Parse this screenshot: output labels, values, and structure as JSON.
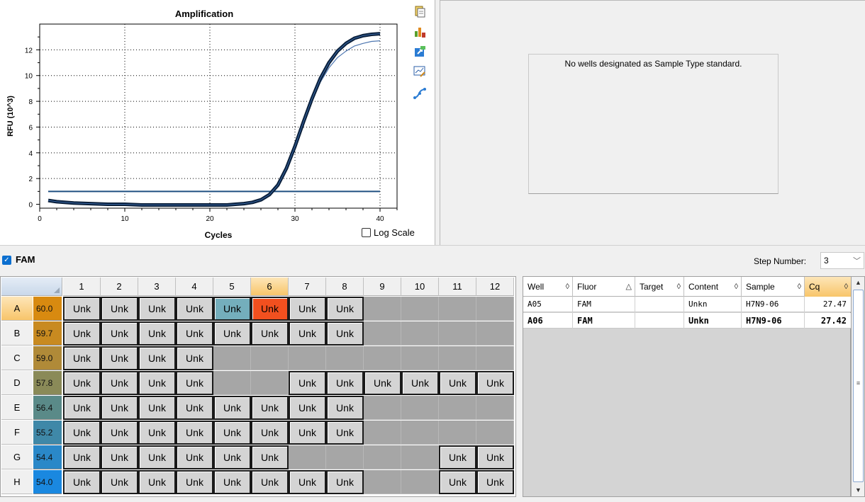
{
  "chart": {
    "title": "Amplification",
    "xlabel": "Cycles",
    "ylabel": "RFU (10^3)",
    "log_scale_label": "Log Scale"
  },
  "chart_data": {
    "type": "line",
    "title": "Amplification",
    "xlabel": "Cycles",
    "ylabel": "RFU (10^3)",
    "xlim": [
      0,
      42
    ],
    "ylim": [
      -0.3,
      14
    ],
    "xticks": [
      "0",
      "10",
      "20",
      "30",
      "40"
    ],
    "yticks": [
      "0",
      "2",
      "4",
      "6",
      "8",
      "10",
      "12"
    ],
    "threshold": 1.0,
    "grid": true,
    "series": [
      {
        "color": "#0a1f3a",
        "x": [
          1,
          2,
          4,
          6,
          8,
          10,
          12,
          14,
          16,
          18,
          20,
          22,
          23,
          24,
          25,
          26,
          27,
          28,
          29,
          30,
          31,
          32,
          33,
          34,
          35,
          36,
          37,
          38,
          39,
          40
        ],
        "y": [
          0.3,
          0.2,
          0.1,
          0.05,
          0.0,
          0.0,
          -0.05,
          -0.05,
          -0.05,
          -0.05,
          -0.05,
          -0.05,
          0.0,
          0.05,
          0.15,
          0.35,
          0.75,
          1.5,
          2.8,
          4.5,
          6.4,
          8.2,
          9.8,
          11.0,
          11.9,
          12.5,
          12.9,
          13.1,
          13.2,
          13.25
        ]
      },
      {
        "color": "#4d76b0",
        "x": [
          1,
          2,
          4,
          6,
          8,
          10,
          12,
          14,
          16,
          18,
          20,
          22,
          23,
          24,
          25,
          26,
          27,
          28,
          29,
          30,
          31,
          32,
          33,
          34,
          35,
          36,
          37,
          38,
          39,
          40
        ],
        "y": [
          0.3,
          0.2,
          0.1,
          0.05,
          0.0,
          0.0,
          -0.05,
          -0.05,
          -0.05,
          -0.05,
          -0.05,
          -0.05,
          0.0,
          0.05,
          0.15,
          0.35,
          0.75,
          1.5,
          2.8,
          4.5,
          6.3,
          8.0,
          9.5,
          10.6,
          11.4,
          11.9,
          12.3,
          12.5,
          12.65,
          12.7
        ]
      }
    ]
  },
  "standard_message": "No wells designated as Sample Type standard.",
  "fluor": {
    "label": "FAM",
    "checked": true
  },
  "step": {
    "label": "Step Number:",
    "value": "3"
  },
  "plate": {
    "columns": [
      "1",
      "2",
      "3",
      "4",
      "5",
      "6",
      "7",
      "8",
      "9",
      "10",
      "11",
      "12"
    ],
    "rows": [
      {
        "label": "A",
        "temp": "60.0",
        "temp_color": "#d88a10",
        "wells": [
          "Unk",
          "Unk",
          "Unk",
          "Unk",
          "Unk",
          "Unk",
          "Unk",
          "Unk",
          "",
          "",
          "",
          ""
        ]
      },
      {
        "label": "B",
        "temp": "59.7",
        "temp_color": "#c88a20",
        "wells": [
          "Unk",
          "Unk",
          "Unk",
          "Unk",
          "Unk",
          "Unk",
          "Unk",
          "Unk",
          "",
          "",
          "",
          ""
        ]
      },
      {
        "label": "C",
        "temp": "59.0",
        "temp_color": "#b08a38",
        "wells": [
          "Unk",
          "Unk",
          "Unk",
          "Unk",
          "",
          "",
          "",
          "",
          "",
          "",
          "",
          ""
        ]
      },
      {
        "label": "D",
        "temp": "57.8",
        "temp_color": "#8a8a58",
        "wells": [
          "Unk",
          "Unk",
          "Unk",
          "Unk",
          "",
          "",
          "Unk",
          "Unk",
          "Unk",
          "Unk",
          "Unk",
          "Unk"
        ]
      },
      {
        "label": "E",
        "temp": "56.4",
        "temp_color": "#5a8a88",
        "wells": [
          "Unk",
          "Unk",
          "Unk",
          "Unk",
          "Unk",
          "Unk",
          "Unk",
          "Unk",
          "",
          "",
          "",
          ""
        ]
      },
      {
        "label": "F",
        "temp": "55.2",
        "temp_color": "#3f88a8",
        "wells": [
          "Unk",
          "Unk",
          "Unk",
          "Unk",
          "Unk",
          "Unk",
          "Unk",
          "Unk",
          "",
          "",
          "",
          ""
        ]
      },
      {
        "label": "G",
        "temp": "54.4",
        "temp_color": "#2a88c8",
        "wells": [
          "Unk",
          "Unk",
          "Unk",
          "Unk",
          "Unk",
          "Unk",
          "",
          "",
          "",
          "",
          "Unk",
          "Unk"
        ]
      },
      {
        "label": "H",
        "temp": "54.0",
        "temp_color": "#1a88e0",
        "wells": [
          "Unk",
          "Unk",
          "Unk",
          "Unk",
          "Unk",
          "Unk",
          "Unk",
          "Unk",
          "",
          "",
          "Unk",
          "Unk"
        ]
      }
    ]
  },
  "table": {
    "headers": [
      "Well",
      "Fluor",
      "Target",
      "Content",
      "Sample",
      "Cq"
    ],
    "sort_icons": [
      "◊",
      "△",
      "◊",
      "◊",
      "◊",
      "◊"
    ],
    "rows": [
      {
        "well": "A05",
        "fluor": "FAM",
        "target": "",
        "content": "Unkn",
        "sample": "H7N9-06",
        "cq": "27.47",
        "bold": false
      },
      {
        "well": "A06",
        "fluor": "FAM",
        "target": "",
        "content": "Unkn",
        "sample": "H7N9-06",
        "cq": "27.42",
        "bold": true
      }
    ]
  },
  "toolbar_icons": [
    "clipboard-icon",
    "chart-bars-icon",
    "export-icon",
    "edit-chart-icon",
    "curve-icon"
  ]
}
